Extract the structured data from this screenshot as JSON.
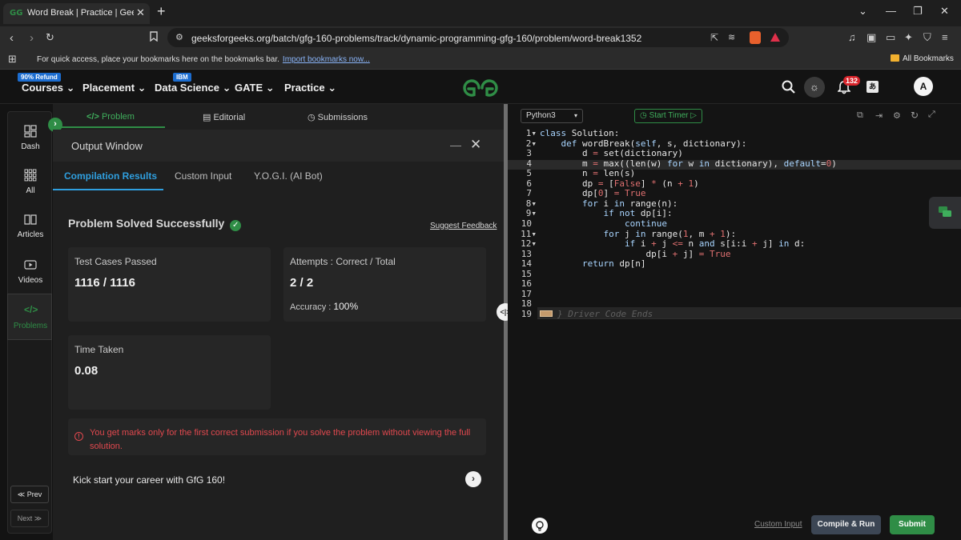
{
  "browser": {
    "tab_title": "Word Break | Practice | GeeksforGeeks",
    "tab_favicon_text": "GG",
    "url": "geeksforgeeks.org/batch/gfg-160-problems/track/dynamic-programming-gfg-160/problem/word-break1352",
    "bookmarks_msg": "For quick access, place your bookmarks here on the bookmarks bar.",
    "bookmarks_link": "Import bookmarks now...",
    "all_bookmarks": "All Bookmarks"
  },
  "site_nav": {
    "courses": "Courses",
    "courses_badge": "90% Refund",
    "placement": "Placement",
    "data_science": "Data Science",
    "data_science_badge": "IBM",
    "gate": "GATE",
    "practice": "Practice",
    "notifications_count": "132",
    "avatar_letter": "A",
    "accent": "#2f8d46"
  },
  "rail": {
    "dash": "Dash",
    "all": "All",
    "articles": "Articles",
    "videos": "Videos",
    "problems": "Problems",
    "prev": "≪ Prev",
    "next": "Next ≫"
  },
  "panel": {
    "tabs": {
      "problem": "Problem",
      "editorial": "Editorial",
      "submissions": "Submissions"
    },
    "output_title": "Output Window",
    "result_tabs": {
      "compilation": "Compilation Results",
      "custom_input": "Custom Input",
      "yogi": "Y.O.G.I. (AI Bot)"
    },
    "status": "Problem Solved Successfully",
    "suggest_feedback": "Suggest Feedback",
    "test_cases": {
      "label": "Test Cases Passed",
      "value": "1116 / 1116"
    },
    "attempts": {
      "label": "Attempts : Correct / Total",
      "value": "2 / 2",
      "accuracy_label": "Accuracy :",
      "accuracy_value": "100%"
    },
    "time": {
      "label": "Time Taken",
      "value": "0.08"
    },
    "notice": "You get marks only for the first correct submission if you solve the problem without viewing the full solution.",
    "career": "Kick start your career with GfG 160!"
  },
  "editor": {
    "language": "Python3",
    "start_timer": "Start Timer",
    "line_numbers": [
      "1",
      "2",
      "3",
      "4",
      "5",
      "6",
      "7",
      "8",
      "9",
      "10",
      "11",
      "12",
      "13",
      "14",
      "15",
      "16",
      "17",
      "18",
      "19"
    ],
    "lines": [
      "class Solution:",
      "    def wordBreak(self, s, dictionary):",
      "        d = set(dictionary)",
      "        m = max((len(w) for w in dictionary), default=0)",
      "        n = len(s)",
      "        dp = [False] * (n + 1)",
      "        dp[0] = True",
      "        for i in range(n):",
      "            if not dp[i]:",
      "                continue",
      "            for j in range(1, m + 1):",
      "                if i + j <= n and s[i:i + j] in d:",
      "                    dp[i + j] = True",
      "        return dp[n]",
      "",
      "",
      "",
      "",
      "} Driver Code Ends"
    ],
    "custom_input": "Custom Input",
    "compile_run": "Compile & Run",
    "submit": "Submit"
  }
}
